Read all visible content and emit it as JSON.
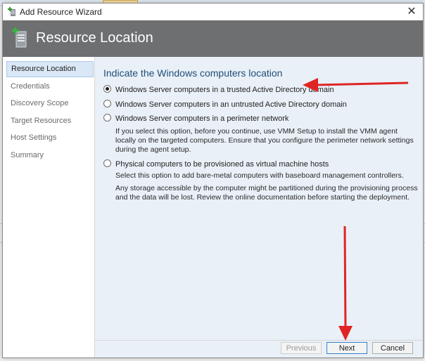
{
  "window": {
    "title": "Add Resource Wizard",
    "close_glyph": "✕"
  },
  "banner": {
    "heading": "Resource Location",
    "icon": "server-add-icon"
  },
  "sidebar": {
    "items": [
      {
        "label": "Resource Location",
        "active": true
      },
      {
        "label": "Credentials"
      },
      {
        "label": "Discovery Scope"
      },
      {
        "label": "Target Resources"
      },
      {
        "label": "Host Settings"
      },
      {
        "label": "Summary"
      }
    ]
  },
  "main": {
    "section_title": "Indicate the Windows computers location",
    "options": [
      {
        "label": "Windows Server computers in a trusted Active Directory domain",
        "checked": true
      },
      {
        "label": "Windows Server computers in an untrusted Active Directory domain",
        "checked": false
      },
      {
        "label": "Windows Server computers in a perimeter network",
        "checked": false
      },
      {
        "label": "Physical computers to be provisioned as virtual machine hosts",
        "checked": false
      }
    ],
    "perimeter_note": "If you select this option, before you continue, use VMM Setup to install the VMM agent locally on the targeted computers. Ensure that you configure the perimeter network settings during the agent setup.",
    "physical_note_1": "Select this option to add bare-metal computers with baseboard management controllers.",
    "physical_note_2": "Any storage accessible by the computer might be partitioned during the provisioning process and the data will be lost. Review the online documentation before starting the deployment."
  },
  "footer": {
    "previous_label": "Previous",
    "next_label": "Next",
    "cancel_label": "Cancel"
  },
  "colors": {
    "banner": "#6d6f70",
    "content_bg": "#e9f0f7",
    "section_title": "#1f4e79",
    "annotation_arrow": "#e02424"
  }
}
